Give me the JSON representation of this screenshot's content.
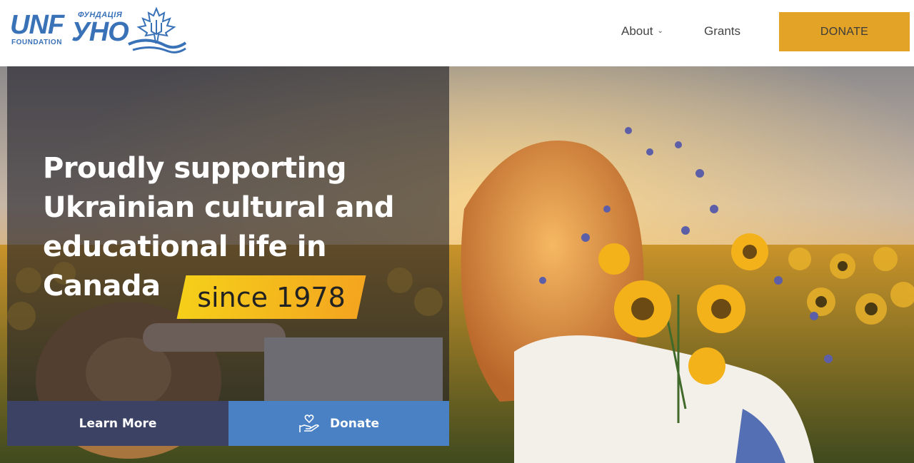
{
  "header": {
    "logo": {
      "text_unf": "UNF",
      "text_foundation": "FOUNDATION",
      "text_fund": "ФУНДАЦІЯ",
      "text_uno": "УНО"
    },
    "nav": {
      "about": "About",
      "grants": "Grants",
      "donate": "DONATE"
    }
  },
  "hero": {
    "headline": "Proudly supporting Ukrainian cultural and educational life in Canada",
    "badge": "since 1978",
    "learn_more": "Learn More",
    "donate": "Donate"
  },
  "colors": {
    "brand_blue": "#3a72b8",
    "donate_gold": "#e3a327",
    "learn_more_bg": "#3b4264",
    "donate_bg": "#4a80c4"
  },
  "icons": {
    "about_dropdown": "chevron-down-icon",
    "donate_button": "hand-heart-icon",
    "logo_mark": "maple-leaf-trident-icon"
  }
}
